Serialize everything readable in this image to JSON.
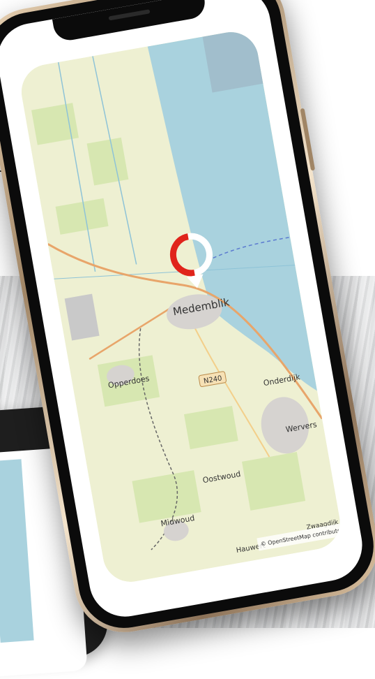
{
  "map": {
    "place_labels": {
      "main_town": "Medemblik",
      "opperdoes": "Opperdoes",
      "onderdijk": "Onderdijk",
      "wervers": "Wervers",
      "oostwoud": "Oostwoud",
      "midwoud": "Midwoud",
      "hauwert": "Hauwert",
      "zwaagdijk": "Zwaagdijk"
    },
    "road_badge": "N240",
    "attribution": "© OpenStreetMap contributors"
  },
  "colors": {
    "water": "#a9d2de",
    "land": "#eef0d2",
    "fields": "#d7e7b1",
    "road": "#e8a56a",
    "marker_red": "#e0241b"
  },
  "icons": {
    "location_marker": "location-pin-icon"
  }
}
